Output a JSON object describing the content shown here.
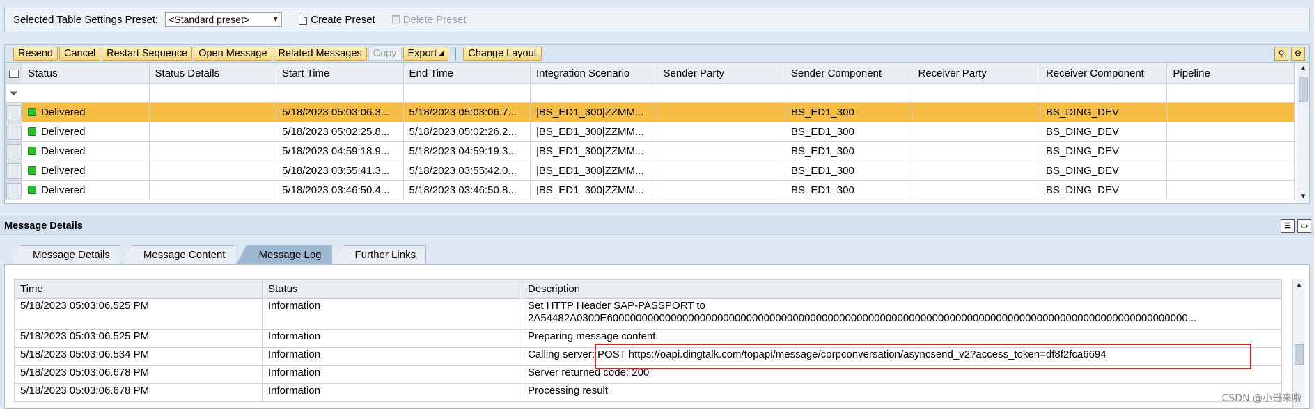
{
  "preset": {
    "label": "Selected Table Settings Preset:",
    "selected": "<Standard preset>",
    "create": "Create Preset",
    "delete": "Delete Preset"
  },
  "toolbar": {
    "buttons": [
      "Resend",
      "Cancel",
      "Restart Sequence",
      "Open Message",
      "Related Messages",
      "Copy",
      "Export",
      "Change Layout"
    ]
  },
  "grid": {
    "columns": [
      "Status",
      "Status Details",
      "Start Time",
      "End Time",
      "Integration Scenario",
      "Sender Party",
      "Sender Component",
      "Receiver Party",
      "Receiver Component",
      "Pipeline"
    ],
    "rows": [
      {
        "status": "Delivered",
        "details": "",
        "start": "5/18/2023 05:03:06.3...",
        "end": "5/18/2023 05:03:06.7...",
        "scenario": "|BS_ED1_300|ZZMM...",
        "sparty": "",
        "scomp": "BS_ED1_300",
        "rparty": "",
        "rcomp": "BS_DING_DEV",
        "pipeline": ""
      },
      {
        "status": "Delivered",
        "details": "",
        "start": "5/18/2023 05:02:25.8...",
        "end": "5/18/2023 05:02:26.2...",
        "scenario": "|BS_ED1_300|ZZMM...",
        "sparty": "",
        "scomp": "BS_ED1_300",
        "rparty": "",
        "rcomp": "BS_DING_DEV",
        "pipeline": ""
      },
      {
        "status": "Delivered",
        "details": "",
        "start": "5/18/2023 04:59:18.9...",
        "end": "5/18/2023 04:59:19.3...",
        "scenario": "|BS_ED1_300|ZZMM...",
        "sparty": "",
        "scomp": "BS_ED1_300",
        "rparty": "",
        "rcomp": "BS_DING_DEV",
        "pipeline": ""
      },
      {
        "status": "Delivered",
        "details": "",
        "start": "5/18/2023 03:55:41.3...",
        "end": "5/18/2023 03:55:42.0...",
        "scenario": "|BS_ED1_300|ZZMM...",
        "sparty": "",
        "scomp": "BS_ED1_300",
        "rparty": "",
        "rcomp": "BS_DING_DEV",
        "pipeline": ""
      },
      {
        "status": "Delivered",
        "details": "",
        "start": "5/18/2023 03:46:50.4...",
        "end": "5/18/2023 03:46:50.8...",
        "scenario": "|BS_ED1_300|ZZMM...",
        "sparty": "",
        "scomp": "BS_ED1_300",
        "rparty": "",
        "rcomp": "BS_DING_DEV",
        "pipeline": ""
      }
    ]
  },
  "details": {
    "title": "Message Details",
    "tabs": [
      "Message Details",
      "Message Content",
      "Message Log",
      "Further Links"
    ],
    "log_columns": [
      "Time",
      "Status",
      "Description"
    ],
    "log_rows": [
      {
        "time": "5/18/2023 05:03:06.525 PM",
        "status": "Information",
        "desc": "Set HTTP Header SAP-PASSPORT to",
        "desc2": "2A54482A0300E6000000000000000000000000000000000000000000000000000000000000000000000000000000000000000000000000000..."
      },
      {
        "time": "5/18/2023 05:03:06.525 PM",
        "status": "Information",
        "desc": "Preparing message content"
      },
      {
        "time": "5/18/2023 05:03:06.534 PM",
        "status": "Information",
        "desc": "Calling server: POST https://oapi.dingtalk.com/topapi/message/corpconversation/asyncsend_v2?access_token=df8f2fca6694"
      },
      {
        "time": "5/18/2023 05:03:06.678 PM",
        "status": "Information",
        "desc": "Server returned code: 200"
      },
      {
        "time": "5/18/2023 05:03:06.678 PM",
        "status": "Information",
        "desc": "Processing result"
      }
    ]
  },
  "watermark": "CSDN @小哥来啦"
}
